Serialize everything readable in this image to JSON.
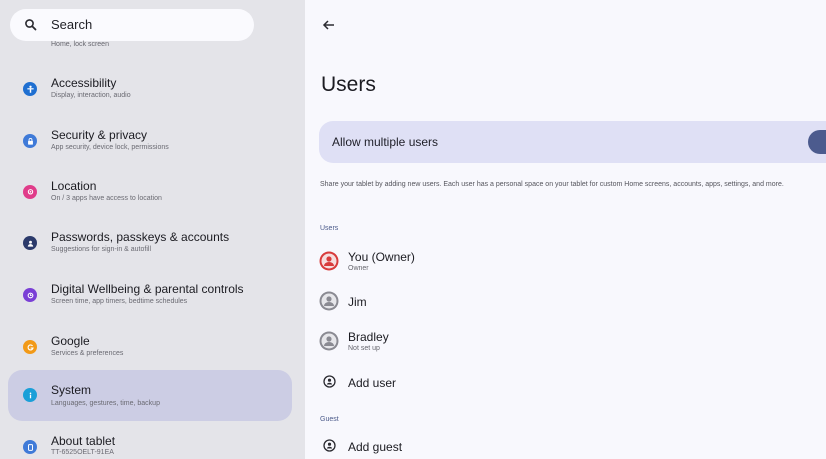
{
  "search": {
    "label": "Search",
    "cut_subtitle": "Home, lock screen"
  },
  "sidebar": {
    "items": [
      {
        "title": "Accessibility",
        "subtitle": "Display, interaction, audio",
        "icon": "accessibility-icon",
        "color": "#1f6fd1"
      },
      {
        "title": "Security & privacy",
        "subtitle": "App security, device lock, permissions",
        "icon": "lock-icon",
        "color": "#3f7ad8"
      },
      {
        "title": "Location",
        "subtitle": "On / 3 apps have access to location",
        "icon": "location-icon",
        "color": "#e03c8a"
      },
      {
        "title": "Passwords, passkeys & accounts",
        "subtitle": "Suggestions for sign-in & autofill",
        "icon": "accounts-icon",
        "color": "#2b3a6b"
      },
      {
        "title": "Digital Wellbeing & parental controls",
        "subtitle": "Screen time, app timers, bedtime schedules",
        "icon": "wellbeing-icon",
        "color": "#7a3fd6"
      },
      {
        "title": "Google",
        "subtitle": "Services & preferences",
        "icon": "google-icon",
        "color": "#f29a18"
      },
      {
        "title": "System",
        "subtitle": "Languages, gestures, time, backup",
        "icon": "info-icon",
        "color": "#1a9fd8"
      },
      {
        "title": "About tablet",
        "subtitle": "TT-6525OELT-91EA",
        "icon": "tablet-icon",
        "color": "#3f7ad8"
      }
    ]
  },
  "main": {
    "title": "Users",
    "toggle_label": "Allow multiple users",
    "toggle_on": true,
    "description": "Share your tablet by adding new users. Each user has a personal space on your tablet for custom Home screens, accounts, apps, settings, and more.",
    "users_header": "Users",
    "users": [
      {
        "name": "You (Owner)",
        "subtitle": "Owner",
        "avatar_color": "#d83b3b"
      },
      {
        "name": "Jim",
        "subtitle": "",
        "avatar_color": "#8a8a92"
      },
      {
        "name": "Bradley",
        "subtitle": "Not set up",
        "avatar_color": "#8a8a92"
      }
    ],
    "add_user_label": "Add user",
    "guest_header": "Guest",
    "add_guest_label": "Add guest"
  }
}
